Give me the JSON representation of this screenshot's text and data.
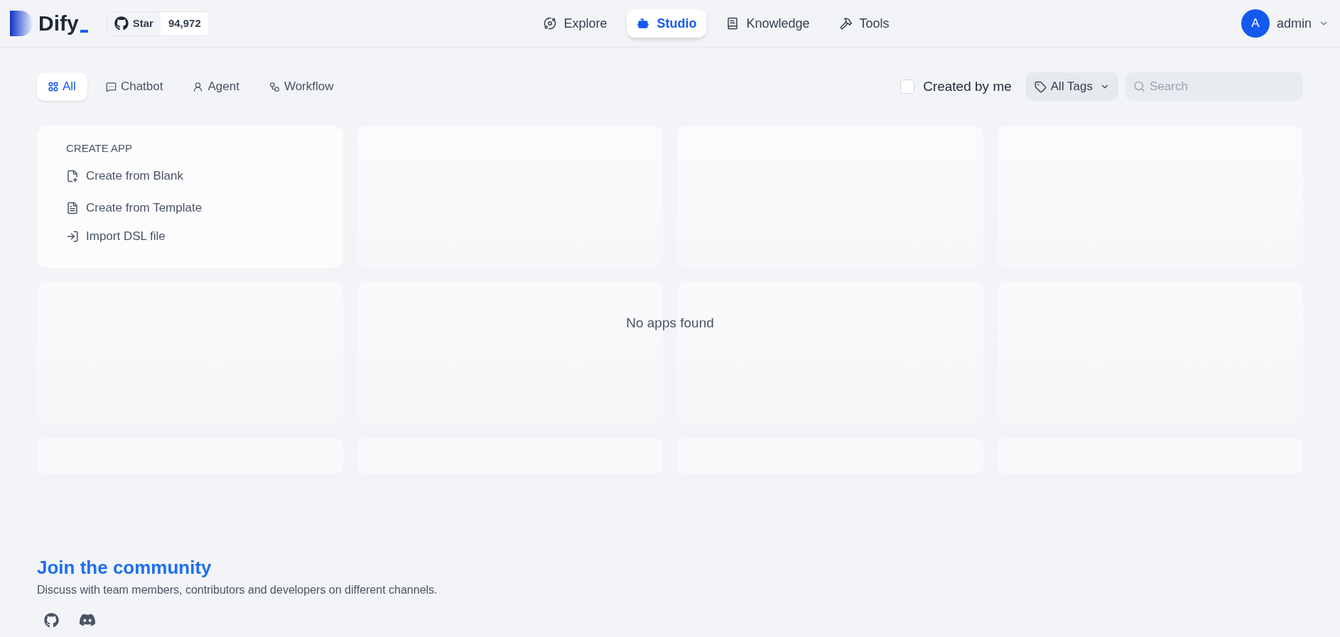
{
  "header": {
    "logo": "Dify",
    "github": {
      "label": "Star",
      "count": "94,972"
    },
    "nav": [
      {
        "label": "Explore",
        "selected": false
      },
      {
        "label": "Studio",
        "selected": true
      },
      {
        "label": "Knowledge",
        "selected": false
      },
      {
        "label": "Tools",
        "selected": false
      }
    ],
    "user": {
      "avatar": "A",
      "name": "admin"
    }
  },
  "filters": {
    "tabs": [
      {
        "label": "All",
        "selected": true
      },
      {
        "label": "Chatbot",
        "selected": false
      },
      {
        "label": "Agent",
        "selected": false
      },
      {
        "label": "Workflow",
        "selected": false
      }
    ],
    "created_by_me": {
      "label": "Created by me",
      "checked": false
    },
    "tags": {
      "label": "All Tags"
    },
    "search": {
      "placeholder": "Search"
    }
  },
  "create_app": {
    "title": "CREATE APP",
    "actions": [
      "Create from Blank",
      "Create from Template",
      "Import DSL file"
    ]
  },
  "empty_message": "No apps found",
  "community": {
    "title": "Join the community",
    "description": "Discuss with team members, contributors and developers on different channels."
  }
}
